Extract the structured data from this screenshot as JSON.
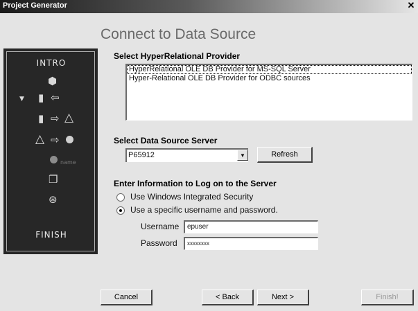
{
  "window": {
    "title": "Project Generator",
    "close_glyph": "✕"
  },
  "page": {
    "heading": "Connect to Data Source"
  },
  "steps": {
    "intro_label": "INTRO",
    "finish_label": "FINISH",
    "name_label": "name",
    "icons": [
      "cube-icon",
      "database-icon",
      "arrow-left-icon",
      "database-to-triangle-icon",
      "triangle-to-sphere-icon",
      "sphere-icon",
      "page-icon",
      "globe-icon"
    ]
  },
  "provider": {
    "label": "Select HyperRelational Provider",
    "items": [
      {
        "text": "HyperRelational OLE DB Provider for MS-SQL Server",
        "selected": true
      },
      {
        "text": "Hyper-Relational OLE DB Provider for ODBC sources",
        "selected": false
      }
    ]
  },
  "server": {
    "label": "Select Data Source Server",
    "value": "P65912",
    "refresh_label": "Refresh"
  },
  "logon": {
    "label": "Enter Information to Log on to the Server",
    "option_windows": "Use Windows Integrated Security",
    "option_specific": "Use a specific username and password.",
    "selected_option": "specific",
    "username_label": "Username",
    "username_value": "epuser",
    "password_label": "Password",
    "password_value": "xxxxxxxx"
  },
  "buttons": {
    "cancel": "Cancel",
    "back": "< Back",
    "next": "Next >",
    "finish": "Finish!"
  }
}
